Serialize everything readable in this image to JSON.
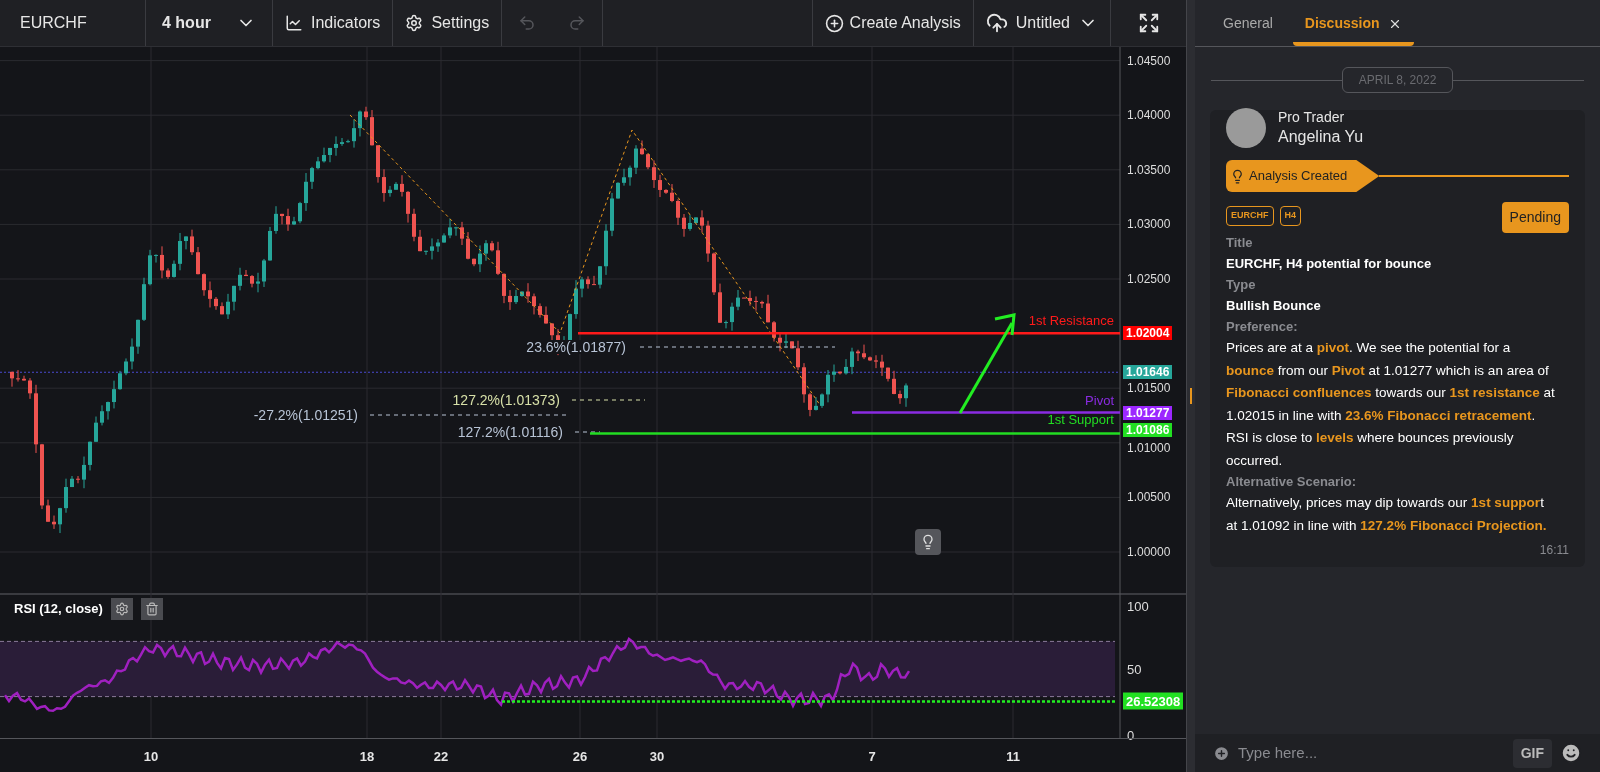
{
  "toolbar": {
    "symbol": "EURCHF",
    "timeframe": "4 hour",
    "indicators_button": "Indicators",
    "settings_button": "Settings",
    "undo_disabled": true,
    "redo_disabled": true,
    "create_analysis_button": "Create Analysis",
    "layout_menu": "Untitled"
  },
  "price_chart": {
    "price_ticks": [
      "1.04500",
      "1.04000",
      "1.03500",
      "1.03000",
      "1.02500",
      "1.01500",
      "1.01000",
      "1.00500",
      "1.00000"
    ],
    "price_labels": [
      {
        "text": "1.02004",
        "color": "#ff0000"
      },
      {
        "text": "1.01646",
        "color": "#26a69a"
      },
      {
        "text": "1.01277",
        "color": "#9c27ff"
      },
      {
        "text": "1.01086",
        "color": "#22e022"
      }
    ],
    "level_lines": [
      {
        "label": "1st Resistance",
        "color": "#ff1a1a"
      },
      {
        "label": "Pivot",
        "color": "#8a2be2"
      },
      {
        "label": "1st Support",
        "color": "#22dd22"
      }
    ],
    "fib_labels": [
      "23.6%(1.01877)",
      "127.2%(1.01373)",
      "-27.2%(1.01251)",
      "127.2%(1.01116)"
    ],
    "date_labels": [
      "10",
      "18",
      "22",
      "26",
      "30",
      "7",
      "11"
    ]
  },
  "rsi_panel": {
    "title": "RSI (12, close)",
    "ticks": [
      "100",
      "50",
      "0"
    ],
    "value_label": "26.52308"
  },
  "side_panel": {
    "tabs": [
      {
        "label": "General",
        "selected": false,
        "closable": false
      },
      {
        "label": "Discussion",
        "selected": true,
        "closable": true
      }
    ],
    "date_separator": "APRIL 8, 2022",
    "message": {
      "role": "Pro Trader",
      "name": "Angelina Yu",
      "event": "Analysis Created",
      "tags": [
        "EURCHF",
        "H4"
      ],
      "status": "Pending",
      "fields": [
        {
          "label": "Title",
          "value": "EURCHF, H4 potential for bounce",
          "kind": "short"
        },
        {
          "label": "Type",
          "value": "Bullish Bounce",
          "kind": "short"
        },
        {
          "label": "Preference:",
          "value": "Prices are at a **pivot**. We see the potential for a **bounce** from our **Pivot** at 1.01277 which is an area of **Fibonacci confluences** towards our **1st resistance** at 1.02015 in line with **23.6% Fibonacci retracement**. RSI is close to **levels** where bounces previously occurred.",
          "kind": "long"
        },
        {
          "label": "Alternative Scenario:",
          "value": "Alternatively, prices may dip towards our **1st suppor**t at 1.01092 in line with **127.2% Fibonacci Projection.**",
          "kind": "long"
        }
      ],
      "time": "16:11"
    },
    "composer": {
      "placeholder": "Type here...",
      "gif_button": "GIF"
    }
  }
}
